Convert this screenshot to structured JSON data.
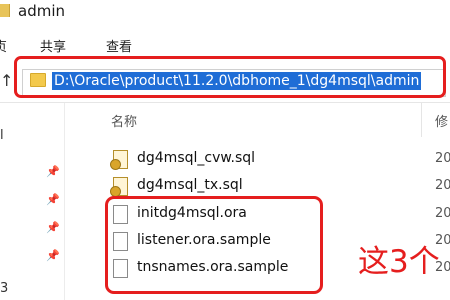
{
  "window": {
    "title": "admin"
  },
  "ribbon": {
    "left_partial": "贞",
    "tabs": [
      "共享",
      "查看"
    ]
  },
  "address_bar": {
    "path": "D:\\Oracle\\product\\11.2.0\\dbhome_1\\dg4msql\\admin"
  },
  "columns": {
    "name": "名称",
    "modified_partial": "修"
  },
  "nav_pane": {
    "char_1": "l",
    "char_2": "3"
  },
  "files": [
    {
      "name": "dg4msql_cvw.sql",
      "type": "sql",
      "date_partial": "20"
    },
    {
      "name": "dg4msql_tx.sql",
      "type": "sql",
      "date_partial": "20"
    },
    {
      "name": "initdg4msql.ora",
      "type": "file",
      "date_partial": "20"
    },
    {
      "name": "listener.ora.sample",
      "type": "file",
      "date_partial": "20"
    },
    {
      "name": "tnsnames.ora.sample",
      "type": "file",
      "date_partial": "20"
    }
  ],
  "annotation": {
    "text": "这3个"
  },
  "colors": {
    "highlight": "#e51e1e",
    "selection": "#1f6dd6"
  }
}
